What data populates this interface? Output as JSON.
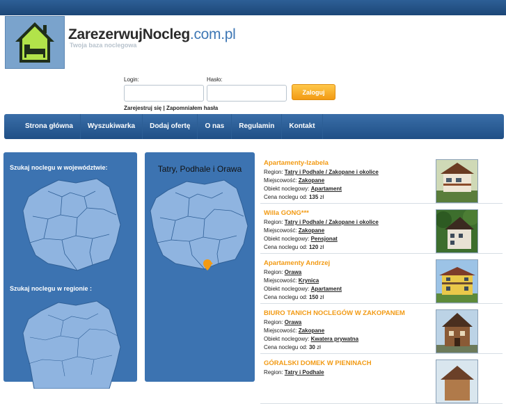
{
  "header": {
    "site_name": "ZarezerwujNocleg",
    "site_domain": ".com.pl",
    "tagline": "Twoja baza noclegowa"
  },
  "login": {
    "login_label": "Login:",
    "password_label": "Hasło:",
    "submit_label": "Zaloguj",
    "register_link": "Zarejestruj się",
    "separator": " | ",
    "forgot_link": "Zapomniałem hasła"
  },
  "nav": {
    "items": [
      "Strona główna",
      "Wyszukiwarka",
      "Dodaj ofertę",
      "O nas",
      "Regulamin",
      "Kontakt"
    ]
  },
  "left_panel": {
    "voivodeship_heading": "Szukaj noclegu w województwie:",
    "region_heading": "Szukaj noclegu w regionie :"
  },
  "region_panel": {
    "title": "Tatry, Podhale i Orawa"
  },
  "labels": {
    "region": "Region: ",
    "city": "Miejscowość: ",
    "type": "Obiekt noclegowy: ",
    "price": "Cena noclegu od: ",
    "currency": " zł"
  },
  "listings": [
    {
      "name": "Apartamenty-Izabela",
      "region": "Tatry i Podhale / Zakopane i okolice",
      "city": "Zakopane",
      "type": "Apartament",
      "price": "135"
    },
    {
      "name": "Willa GONG***",
      "region": "Tatry i Podhale / Zakopane i okolice",
      "city": "Zakopane",
      "type": "Pensjonat",
      "price": "120"
    },
    {
      "name": "Apartamenty Andrzej",
      "region": "Orawa",
      "city": "Krynica",
      "type": "Apartament",
      "price": "150"
    },
    {
      "name": "BIURO TANICH NOCLEGÓW W ZAKOPANEM",
      "region": "Orawa",
      "city": "Zakopane",
      "type": "Kwatera prywatna",
      "price": "30"
    },
    {
      "name": "GÓRALSKI DOMEK W PIENINACH",
      "region": "Tatry i Podhale",
      "city": "",
      "type": "",
      "price": ""
    }
  ],
  "colors": {
    "primary_blue": "#3c73b1",
    "accent_orange": "#f29a13",
    "map_fill": "#8fb4e0"
  }
}
